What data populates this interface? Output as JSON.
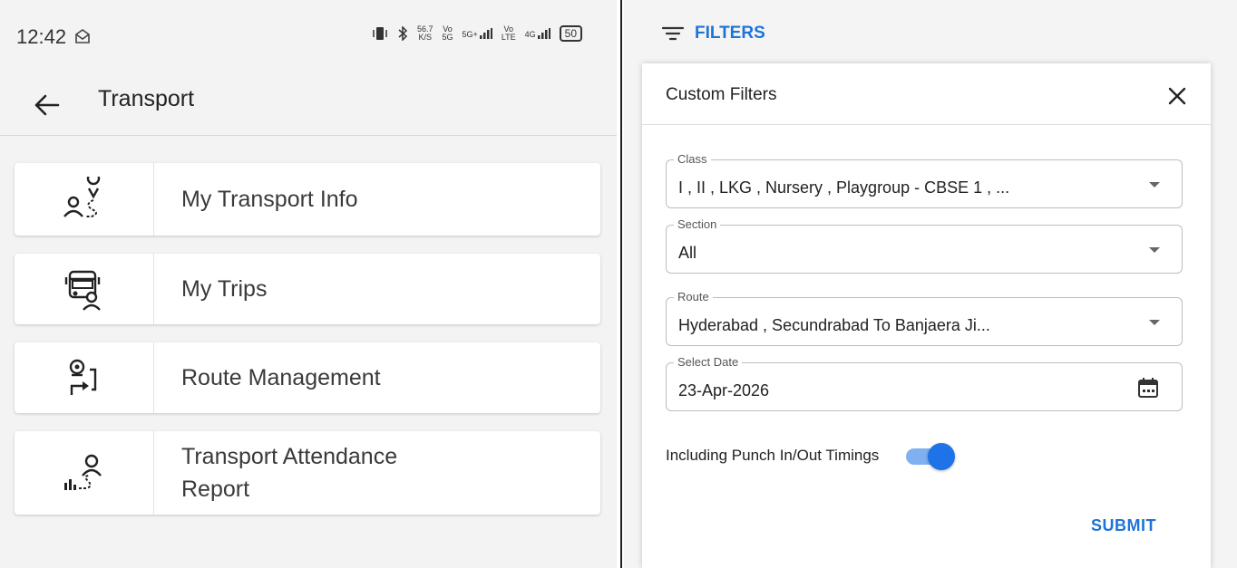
{
  "status": {
    "time": "12:42",
    "speed_top": "56.7",
    "speed_unit": "K/S",
    "net1_top": "Vo",
    "net1_bottom": "5G",
    "net2_top": "5G+",
    "net3_top": "Vo",
    "net3_bottom": "LTE",
    "net4_top": "4G",
    "battery": "50"
  },
  "appbar": {
    "title": "Transport"
  },
  "menu": {
    "items": [
      {
        "label": "My Transport Info",
        "icon": "person-route-icon"
      },
      {
        "label": "My Trips",
        "icon": "bus-person-icon"
      },
      {
        "label": "Route Management",
        "icon": "route-pin-icon"
      },
      {
        "label_line1": "Transport Attendance",
        "label_line2": "Report",
        "icon": "attendance-report-icon"
      }
    ]
  },
  "filters": {
    "bar_label": "FILTERS",
    "dialog_title": "Custom Filters",
    "fields": [
      {
        "label": "Class",
        "value": "I , II , LKG , Nursery , Playgroup - CBSE 1 , ..."
      },
      {
        "label": "Section",
        "value": "All"
      },
      {
        "label": "Route",
        "value": "Hyderabad , Secundrabad To Banjaera Ji..."
      },
      {
        "label": "Select Date",
        "value": "23-Apr-2026"
      }
    ],
    "toggle_label": "Including Punch In/Out Timings",
    "toggle_on": true,
    "submit_label": "SUBMIT"
  },
  "colors": {
    "accent": "#1e73d9",
    "toggle_track": "#7fb0f0",
    "toggle_thumb": "#1e73e8"
  }
}
